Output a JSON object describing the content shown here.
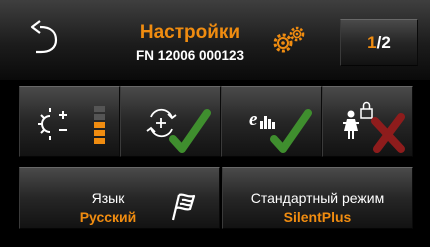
{
  "header": {
    "back_icon": "back-arrow-icon",
    "title": "Настройки",
    "subtitle": "FN 12006 000123",
    "gear_icon": "gears-icon",
    "page": {
      "current": "1",
      "separator": "/",
      "total": "2"
    }
  },
  "features": [
    {
      "name": "brightness",
      "icon": "brightness-icon",
      "level_icon": "level-bars-icon",
      "level_bars_lit": 3,
      "level_bars_total": 5
    },
    {
      "name": "auto-refresh",
      "icon": "refresh-add-icon",
      "status": "enabled",
      "status_icon": "check-icon"
    },
    {
      "name": "eco-energy",
      "icon": "eco-energy-icon",
      "status": "enabled",
      "status_icon": "check-icon"
    },
    {
      "name": "child-lock",
      "icon": "child-lock-icon",
      "status": "disabled",
      "status_icon": "cross-icon"
    }
  ],
  "language": {
    "label": "Язык",
    "value": "Русский",
    "icon": "flag-icon"
  },
  "mode": {
    "label": "Стандартный режим",
    "value": "SilentPlus"
  },
  "colors": {
    "accent": "#f08c10",
    "check": "#3f8e2e",
    "cross": "#8e1c1c",
    "background": "#000000"
  }
}
